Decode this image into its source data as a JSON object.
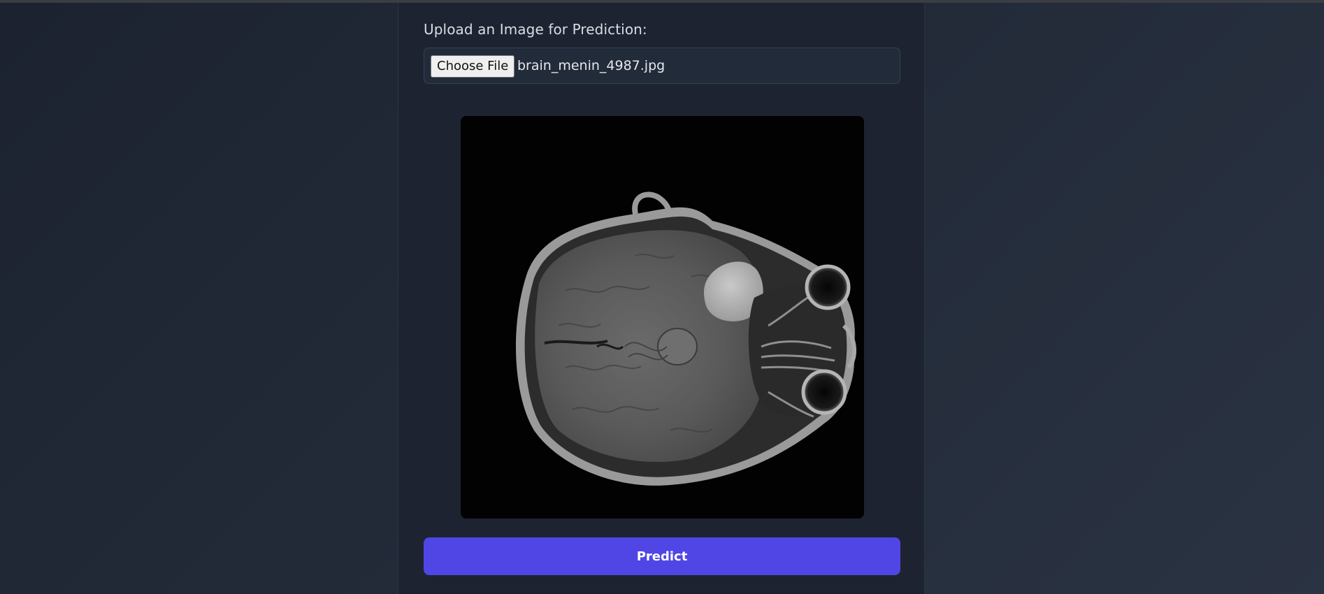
{
  "upload": {
    "label": "Upload an Image for Prediction:",
    "choose_file_label": "Choose File",
    "selected_file": "brain_menin_4987.jpg"
  },
  "preview": {
    "image_description_icon": "brain-mri-image"
  },
  "actions": {
    "predict_label": "Predict"
  },
  "colors": {
    "background": "#1f2532",
    "panel": "#1d2330",
    "accent": "#4f46e5",
    "text": "#d9dde5"
  }
}
